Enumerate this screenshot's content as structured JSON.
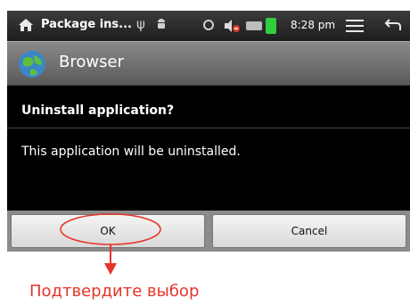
{
  "status_bar": {
    "title": "Package ins...",
    "time": "8:28 pm"
  },
  "app_title": {
    "name": "Browser"
  },
  "dialog": {
    "question": "Uninstall application?",
    "message": "This application will be uninstalled."
  },
  "buttons": {
    "ok": "OK",
    "cancel": "Cancel"
  },
  "annotation": {
    "caption": "Подтвердите выбор",
    "color": "#e5342a"
  },
  "icons": [
    "home-icon",
    "usb-icon",
    "android-icon",
    "gps-icon",
    "volume-icon",
    "battery-icon",
    "charging-icon",
    "menu-icon",
    "back-icon",
    "globe-icon"
  ]
}
